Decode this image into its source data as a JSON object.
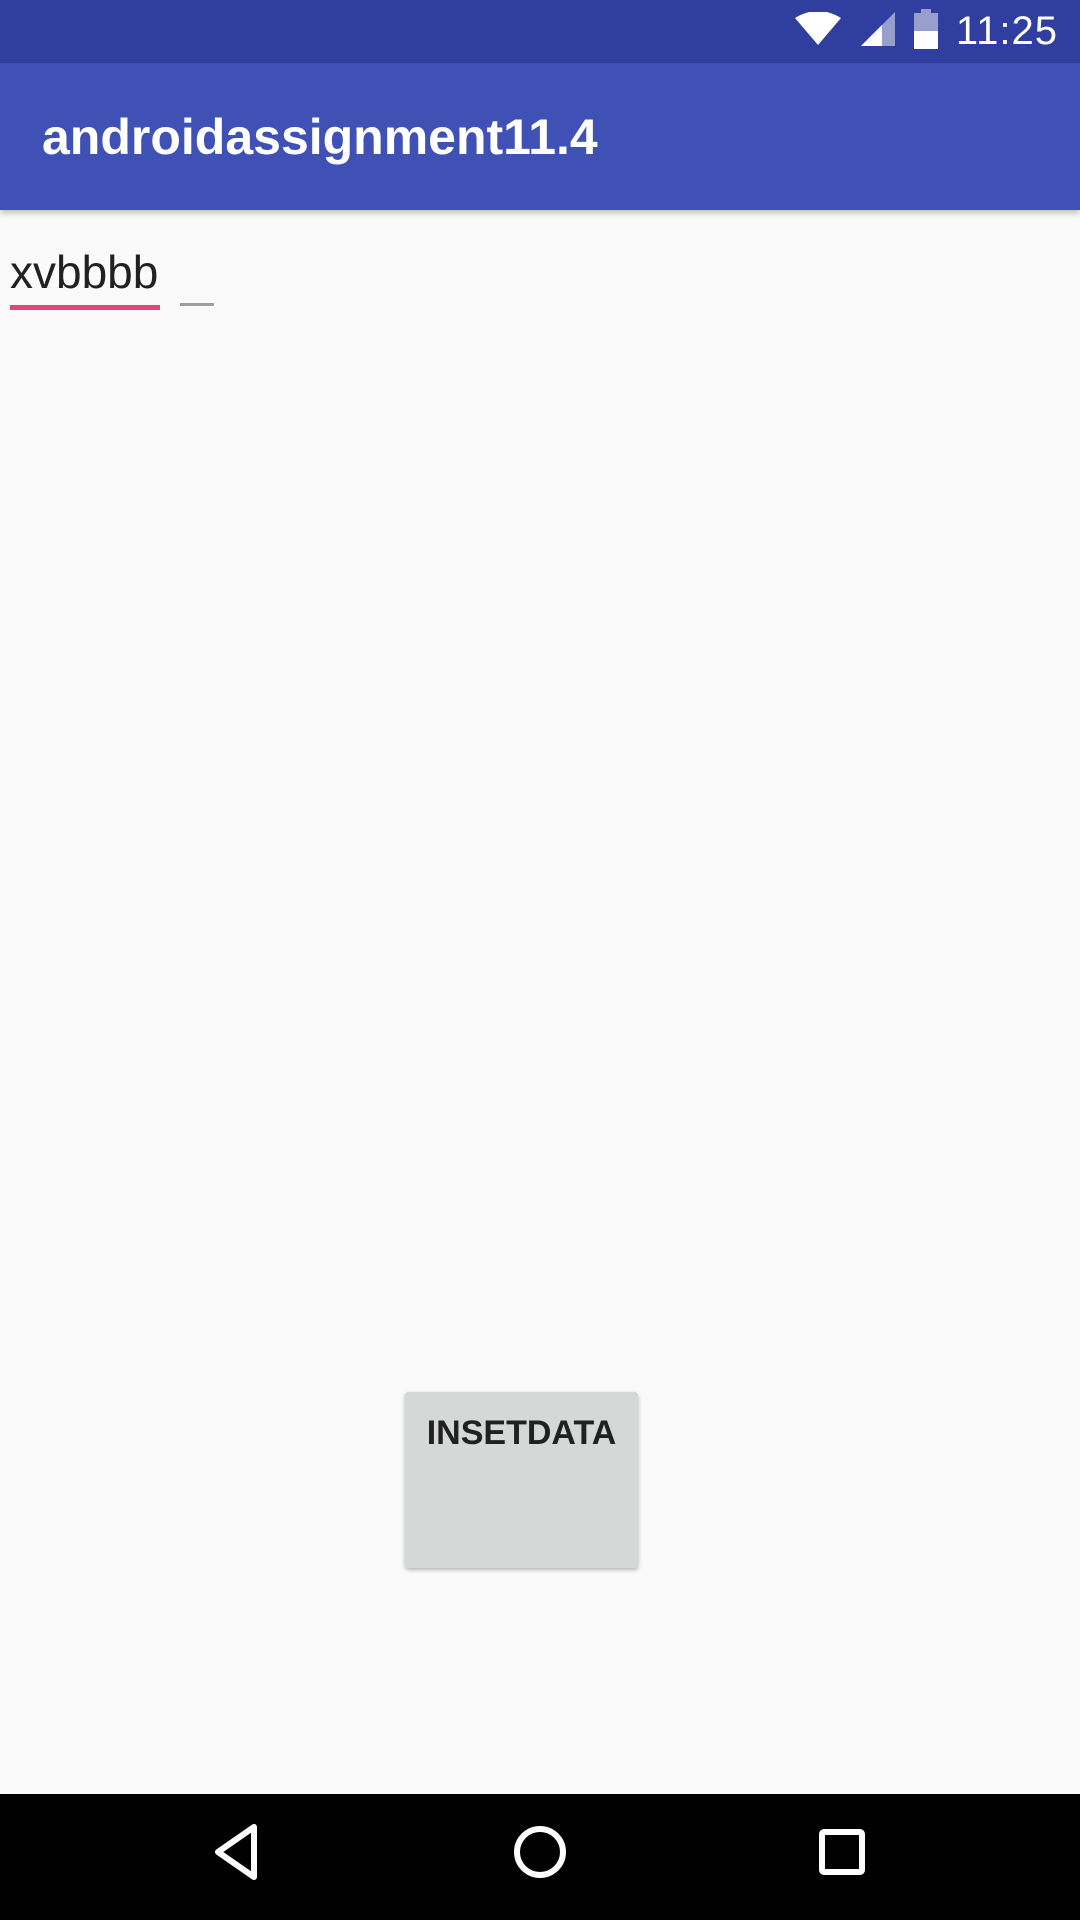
{
  "status_bar": {
    "time": "11:25",
    "icons": [
      "wifi-icon",
      "cell-signal-icon",
      "battery-icon"
    ],
    "background": "#303f9f"
  },
  "app_bar": {
    "title": "androidassignment11.4",
    "background": "#3f51b5"
  },
  "form": {
    "text_field_value": "xvbbbb",
    "accent_color": "#ec407a"
  },
  "actions": {
    "insert_label": "INSETDATA"
  },
  "nav_bar": {
    "buttons": [
      "back-icon",
      "home-icon",
      "recents-icon"
    ]
  }
}
